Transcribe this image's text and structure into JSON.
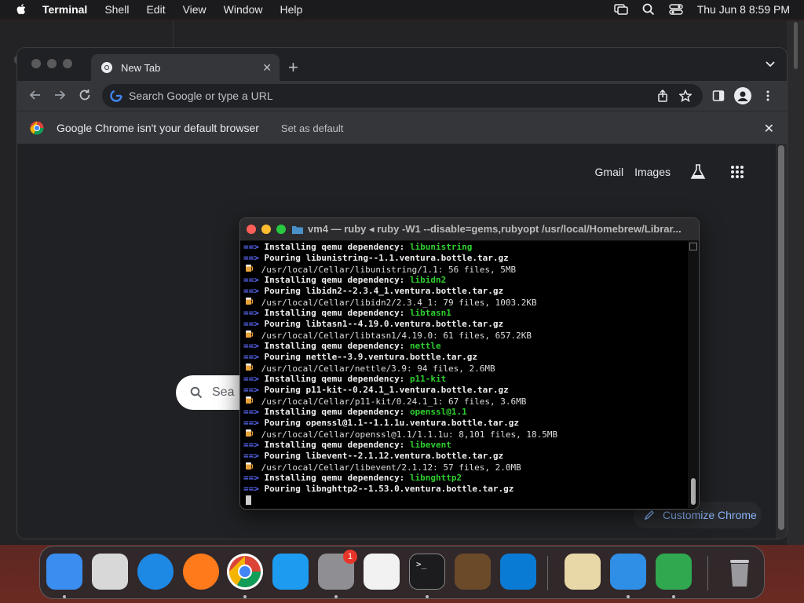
{
  "menubar": {
    "app": "Terminal",
    "items": [
      "Shell",
      "Edit",
      "View",
      "Window",
      "Help"
    ],
    "clock": "Thu Jun 8  8:59 PM"
  },
  "chrome": {
    "tab_title": "New Tab",
    "omnibox_placeholder": "Search Google or type a URL",
    "infobar_message": "Google Chrome isn't your default browser",
    "infobar_action": "Set as default",
    "links": {
      "gmail": "Gmail",
      "images": "Images"
    },
    "search_placeholder": "Sea",
    "customize_label": "Customize Chrome"
  },
  "terminal": {
    "title": "vm4 — ruby ◂ ruby -W1 --disable=gems,rubyopt /usr/local/Homebrew/Librar...",
    "lines": [
      {
        "kind": "install",
        "prefix": "==>",
        "text": "Installing qemu dependency: ",
        "dep": "libunistring"
      },
      {
        "kind": "pour",
        "prefix": "==>",
        "text": "Pouring libunistring--1.1.ventura.bottle.tar.gz"
      },
      {
        "kind": "beer",
        "text": "/usr/local/Cellar/libunistring/1.1: 56 files, 5MB"
      },
      {
        "kind": "install",
        "prefix": "==>",
        "text": "Installing qemu dependency: ",
        "dep": "libidn2"
      },
      {
        "kind": "pour",
        "prefix": "==>",
        "text": "Pouring libidn2--2.3.4_1.ventura.bottle.tar.gz"
      },
      {
        "kind": "beer",
        "text": "/usr/local/Cellar/libidn2/2.3.4_1: 79 files, 1003.2KB"
      },
      {
        "kind": "install",
        "prefix": "==>",
        "text": "Installing qemu dependency: ",
        "dep": "libtasn1"
      },
      {
        "kind": "pour",
        "prefix": "==>",
        "text": "Pouring libtasn1--4.19.0.ventura.bottle.tar.gz"
      },
      {
        "kind": "beer",
        "text": "/usr/local/Cellar/libtasn1/4.19.0: 61 files, 657.2KB"
      },
      {
        "kind": "install",
        "prefix": "==>",
        "text": "Installing qemu dependency: ",
        "dep": "nettle"
      },
      {
        "kind": "pour",
        "prefix": "==>",
        "text": "Pouring nettle--3.9.ventura.bottle.tar.gz"
      },
      {
        "kind": "beer",
        "text": "/usr/local/Cellar/nettle/3.9: 94 files, 2.6MB"
      },
      {
        "kind": "install",
        "prefix": "==>",
        "text": "Installing qemu dependency: ",
        "dep": "p11-kit"
      },
      {
        "kind": "pour",
        "prefix": "==>",
        "text": "Pouring p11-kit--0.24.1_1.ventura.bottle.tar.gz"
      },
      {
        "kind": "beer",
        "text": "/usr/local/Cellar/p11-kit/0.24.1_1: 67 files, 3.6MB"
      },
      {
        "kind": "install",
        "prefix": "==>",
        "text": "Installing qemu dependency: ",
        "dep": "openssl@1.1"
      },
      {
        "kind": "pour",
        "prefix": "==>",
        "text": "Pouring openssl@1.1--1.1.1u.ventura.bottle.tar.gz"
      },
      {
        "kind": "beer",
        "text": "/usr/local/Cellar/openssl@1.1/1.1.1u: 8,101 files, 18.5MB"
      },
      {
        "kind": "install",
        "prefix": "==>",
        "text": "Installing qemu dependency: ",
        "dep": "libevent"
      },
      {
        "kind": "pour",
        "prefix": "==>",
        "text": "Pouring libevent--2.1.12.ventura.bottle.tar.gz"
      },
      {
        "kind": "beer",
        "text": "/usr/local/Cellar/libevent/2.1.12: 57 files, 2.0MB"
      },
      {
        "kind": "install",
        "prefix": "==>",
        "text": "Installing qemu dependency: ",
        "dep": "libnghttp2"
      },
      {
        "kind": "pour",
        "prefix": "==>",
        "text": "Pouring libnghttp2--1.53.0.ventura.bottle.tar.gz"
      }
    ]
  },
  "dock": {
    "apps": [
      {
        "name": "finder-icon",
        "color": "#3a8ef0",
        "running": true
      },
      {
        "name": "launchpad-icon",
        "color": "#d8d8d8",
        "running": false
      },
      {
        "name": "safari-icon",
        "color": "#1e88e5",
        "running": false
      },
      {
        "name": "firefox-icon",
        "color": "#ff7a1a",
        "running": false
      },
      {
        "name": "chrome-icon",
        "color": "#ffffff",
        "running": true
      },
      {
        "name": "app-store-icon",
        "color": "#1d9bf0",
        "running": false
      },
      {
        "name": "system-settings-icon",
        "color": "#8e8e93",
        "running": true,
        "badge": "1"
      },
      {
        "name": "textedit-icon",
        "color": "#f2f2f2",
        "running": false
      },
      {
        "name": "terminal-icon",
        "color": "#1c1c1e",
        "running": true
      },
      {
        "name": "garageband-icon",
        "color": "#6b4a2a",
        "running": false
      },
      {
        "name": "vscode-icon",
        "color": "#0a7bd4",
        "running": false
      },
      {
        "name": "archive-utility-icon",
        "color": "#e8d8a8",
        "running": false
      },
      {
        "name": "network-app-icon",
        "color": "#2f8ee5",
        "running": true
      },
      {
        "name": "game-app-icon",
        "color": "#2fa84f",
        "running": true
      },
      {
        "name": "trash-icon",
        "color": "#9a9a9e",
        "running": false
      }
    ]
  }
}
